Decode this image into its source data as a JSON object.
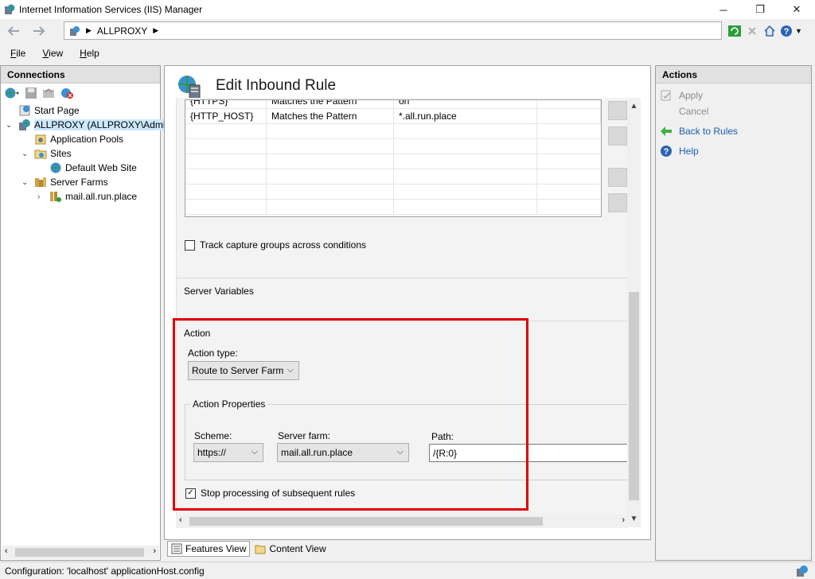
{
  "window": {
    "title": "Internet Information Services (IIS) Manager",
    "controls": {
      "minimize": "─",
      "maximize": "❐",
      "close": "✕"
    }
  },
  "address": {
    "path": "ALLPROXY"
  },
  "menu": [
    "File",
    "View",
    "Help"
  ],
  "connections": {
    "header": "Connections",
    "tree": [
      {
        "label": "Start Page",
        "icon": "start-page-icon"
      },
      {
        "label": "ALLPROXY (ALLPROXY\\Admi",
        "icon": "server-icon"
      },
      {
        "label": "Application Pools",
        "icon": "app-pools-icon"
      },
      {
        "label": "Sites",
        "icon": "sites-folder-icon"
      },
      {
        "label": "Default Web Site",
        "icon": "globe-icon"
      },
      {
        "label": "Server Farms",
        "icon": "server-farms-icon"
      },
      {
        "label": "mail.all.run.place",
        "icon": "server-farm-icon"
      }
    ]
  },
  "center": {
    "page_title": "Edit Inbound Rule",
    "conditions": {
      "partial_row": [
        "{HTTPS}",
        "Matches the Pattern",
        "on"
      ],
      "rows": [
        [
          "{HTTP_HOST}",
          "Matches the Pattern",
          "*.all.run.place"
        ]
      ]
    },
    "track_capture_label": "Track capture groups across conditions",
    "server_variables_label": "Server Variables",
    "action": {
      "section_label": "Action",
      "type_label": "Action type:",
      "type_value": "Route to Server Farm",
      "properties_label": "Action Properties",
      "scheme_label": "Scheme:",
      "scheme_value": "https://",
      "farm_label": "Server farm:",
      "farm_value": "mail.all.run.place",
      "path_label": "Path:",
      "path_value": "/{R:0}",
      "stop_processing_label": "Stop processing of subsequent rules",
      "stop_processing_checked": true
    }
  },
  "view_tabs": {
    "features": "Features View",
    "content": "Content View"
  },
  "actions": {
    "header": "Actions",
    "items": [
      {
        "label": "Apply",
        "icon": "apply-icon",
        "enabled": false
      },
      {
        "label": "Cancel",
        "icon": "cancel-icon",
        "enabled": false
      },
      {
        "label": "Back to Rules",
        "icon": "back-arrow-icon",
        "enabled": true
      },
      {
        "label": "Help",
        "icon": "help-icon",
        "enabled": true
      }
    ]
  },
  "status": {
    "text": "Configuration: 'localhost' applicationHost.config"
  },
  "colors": {
    "highlight_frame": "#e00000",
    "link": "#1a5fb4",
    "selection": "#cce8ff"
  }
}
